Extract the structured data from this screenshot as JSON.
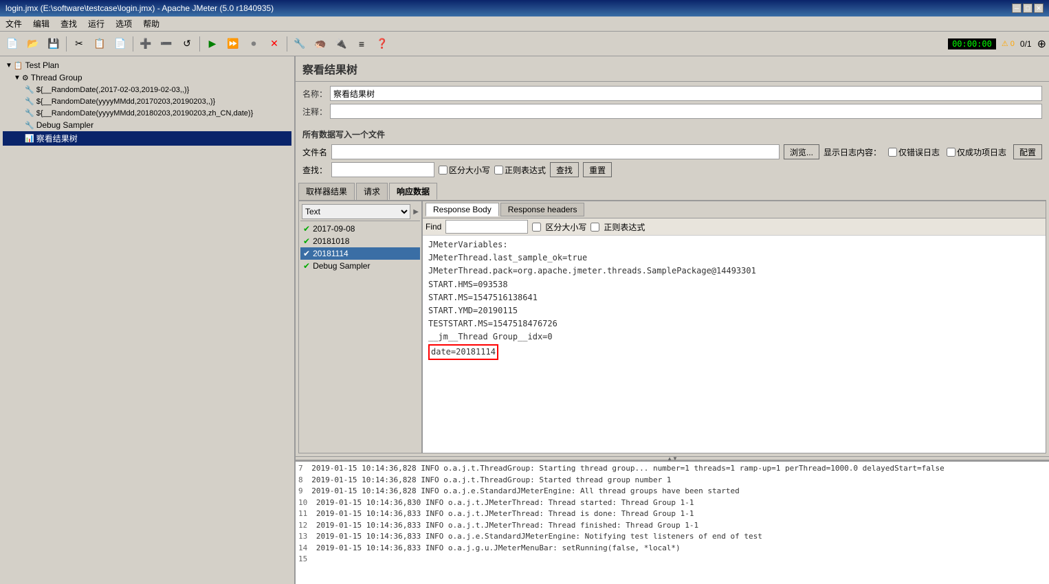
{
  "window": {
    "title": "login.jmx (E:\\software\\testcase\\login.jmx) - Apache JMeter (5.0 r1840935)"
  },
  "titlebar": {
    "minimize": "─",
    "maximize": "□",
    "close": "✕"
  },
  "menubar": {
    "items": [
      "文件",
      "编辑",
      "查找",
      "运行",
      "选项",
      "帮助"
    ]
  },
  "toolbar": {
    "buttons": [
      "📄",
      "💾",
      "🖫",
      "✂️",
      "📋",
      "📄",
      "➕",
      "➖",
      "⟳",
      "▶",
      "⏩",
      "⏺",
      "✕",
      "🔧",
      "🔨",
      "🦔",
      "🔌",
      "≡",
      "❓"
    ],
    "timer": "00:00:00",
    "warning": "⚠ 0",
    "ratio": "0/1"
  },
  "left_panel": {
    "tree_items": [
      {
        "id": "test-plan",
        "label": "Test Plan",
        "indent": 0,
        "icon": "📋",
        "toggle": "▼",
        "selected": false
      },
      {
        "id": "thread-group",
        "label": "Thread Group",
        "indent": 1,
        "icon": "⚙",
        "toggle": "▼",
        "selected": false
      },
      {
        "id": "random1",
        "label": "${__RandomDate(,2017-02-03,2019-02-03,,)}",
        "indent": 2,
        "icon": "🔧",
        "toggle": "",
        "selected": false
      },
      {
        "id": "random2",
        "label": "${__RandomDate(yyyyMMdd,20170203,20190203,,)}",
        "indent": 2,
        "icon": "🔧",
        "toggle": "",
        "selected": false
      },
      {
        "id": "random3",
        "label": "${__RandomDate(yyyyMMdd,20180203,20190203,zh_CN,date)}",
        "indent": 2,
        "icon": "🔧",
        "toggle": "",
        "selected": false
      },
      {
        "id": "debug-sampler",
        "label": "Debug Sampler",
        "indent": 2,
        "icon": "🔧",
        "toggle": "",
        "selected": false
      },
      {
        "id": "view-results",
        "label": "察看结果树",
        "indent": 2,
        "icon": "📊",
        "toggle": "",
        "selected": true
      }
    ]
  },
  "right_panel": {
    "title": "察看结果树",
    "name_label": "名称：",
    "name_value": "察看结果树",
    "comment_label": "注释：",
    "comment_value": "",
    "file_section_title": "所有数据写入一个文件",
    "file_label": "文件名",
    "file_value": "",
    "browse_label": "浏览...",
    "log_content_label": "显示日志内容：",
    "error_log_label": "仅错误日志",
    "success_log_label": "仅成功项日志",
    "config_label": "配置",
    "search_label": "查找：",
    "search_placeholder": "",
    "case_sensitive_label": "区分大小写",
    "regex_label": "正则表达式",
    "find_btn": "查找",
    "reset_btn": "重置",
    "tabs": [
      {
        "id": "sampler-result",
        "label": "取样器结果"
      },
      {
        "id": "request",
        "label": "请求"
      },
      {
        "id": "response-data",
        "label": "响应数据"
      }
    ],
    "active_tab": "response-data",
    "format_dropdown": "Text",
    "list_entries": [
      {
        "id": "entry-1",
        "label": "2017-09-08",
        "status": "success"
      },
      {
        "id": "entry-2",
        "label": "20181018",
        "status": "success"
      },
      {
        "id": "entry-3",
        "label": "20181114",
        "status": "success",
        "selected": true
      },
      {
        "id": "entry-4",
        "label": "Debug Sampler",
        "status": "success"
      }
    ],
    "sub_tabs": [
      {
        "id": "response-body",
        "label": "Response Body",
        "active": true
      },
      {
        "id": "response-headers",
        "label": "Response headers",
        "active": false
      }
    ],
    "find_bar": {
      "label": "Find",
      "case_label": "区分大小写",
      "regex_label": "正则表达式"
    },
    "response_body_lines": [
      "JMeterVariables:",
      "JMeterThread.last_sample_ok=true",
      "JMeterThread.pack=org.apache.jmeter.threads.SamplePackage@14493301",
      "START.HMS=093538",
      "START.MS=1547516138641",
      "START.YMD=20190115",
      "TESTSTART.MS=1547518476726",
      "__jm__Thread Group__idx=0",
      "date=20181114"
    ],
    "highlighted_line_index": 8,
    "highlighted_line_text": "date=20181114"
  },
  "log_panel": {
    "lines": [
      {
        "num": "7",
        "text": "2019-01-15 10:14:36,828 INFO o.a.j.t.ThreadGroup: Starting thread group... number=1 threads=1 ramp-up=1 perThread=1000.0 delayedStart=false"
      },
      {
        "num": "8",
        "text": "2019-01-15 10:14:36,828 INFO o.a.j.t.ThreadGroup: Started thread group number 1"
      },
      {
        "num": "9",
        "text": "2019-01-15 10:14:36,828 INFO o.a.j.e.StandardJMeterEngine: All thread groups have been started"
      },
      {
        "num": "10",
        "text": "2019-01-15 10:14:36,830 INFO o.a.j.t.JMeterThread: Thread started: Thread Group 1-1"
      },
      {
        "num": "11",
        "text": "2019-01-15 10:14:36,833 INFO o.a.j.t.JMeterThread: Thread is done: Thread Group 1-1"
      },
      {
        "num": "12",
        "text": "2019-01-15 10:14:36,833 INFO o.a.j.t.JMeterThread: Thread finished: Thread Group 1-1"
      },
      {
        "num": "13",
        "text": "2019-01-15 10:14:36,833 INFO o.a.j.e.StandardJMeterEngine: Notifying test listeners of end of test"
      },
      {
        "num": "14",
        "text": "2019-01-15 10:14:36,833 INFO o.a.j.g.u.JMeterMenuBar: setRunning(false, *local*)"
      },
      {
        "num": "15",
        "text": ""
      }
    ]
  },
  "status_bar": {
    "url": "https://jdo.coding.net/r1840935"
  }
}
